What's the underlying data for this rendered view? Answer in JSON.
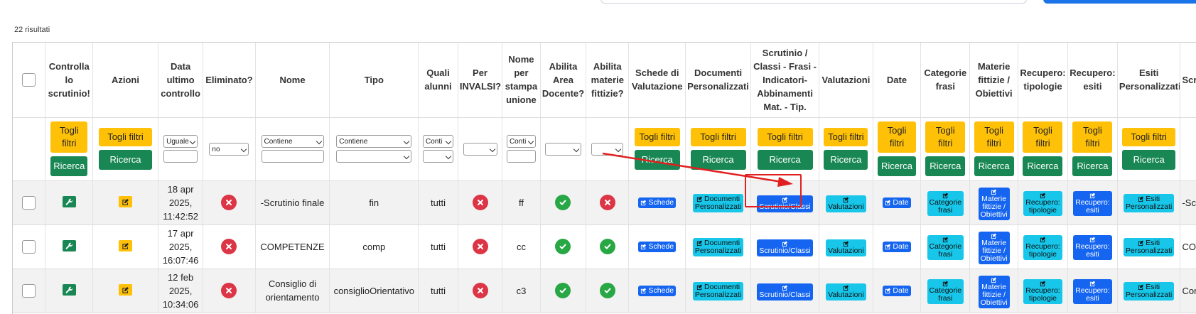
{
  "results_count": "22 risultati",
  "headers": [
    "",
    "Controlla lo scrutinio!",
    "Azioni",
    "Data ultimo controllo",
    "Eliminato?",
    "Nome",
    "Tipo",
    "Quali alunni",
    "Per INVALSI?",
    "Nome per stampa unione",
    "Abilita Area Docente?",
    "Abilita materie fittizie?",
    "Schede di Valutazione",
    "Documenti Personalizzati",
    "Scrutinio / Classi - Frasi - Indicatori- Abbinamenti Mat. - Tip.",
    "Valutazioni",
    "Date",
    "Categorie frasi",
    "Materie fittizie / Obiettivi",
    "Recupero: tipologie",
    "Recupero: esiti",
    "Esiti Personalizzati",
    "Scr"
  ],
  "filters": {
    "togli_filtri": "Togli filtri",
    "ricerca": "Ricerca",
    "data_op": "Uguale",
    "eliminato": "no",
    "nome_op": "Contiene",
    "tipo_op": "Contiene",
    "alunni_op": "Conti",
    "stampa_op": "Conti"
  },
  "buttons": {
    "schede": "Schede",
    "documenti_l1": "Documenti",
    "documenti_l2": "Personalizzati",
    "scrutinio_classi": "Scrutinio/Classi",
    "valutazioni": "Valutazioni",
    "date": "Date",
    "categorie_l1": "Categorie",
    "categorie_l2": "frasi",
    "materie_l1": "Materie",
    "materie_l2": "fittizie /",
    "materie_l3": "Obiettivi",
    "rec_tip_l1": "Recupero:",
    "rec_tip_l2": "tipologie",
    "rec_esiti_l1": "Recupero:",
    "rec_esiti_l2": "esiti",
    "esiti_l1": "Esiti",
    "esiti_l2": "Personalizzati"
  },
  "rows": [
    {
      "data_l1": "18 apr",
      "data_l2": "2025,",
      "data_l3": "11:42:52",
      "eliminato": "no",
      "nome_l1": "-Scrutinio finale",
      "nome_l2": "",
      "tipo": "fin",
      "alunni": "tutti",
      "invalsi": "no",
      "stampa": "ff",
      "area_docente": "yes",
      "materie_fittizie": "no",
      "last": "-Scruti"
    },
    {
      "data_l1": "17 apr",
      "data_l2": "2025,",
      "data_l3": "16:07:46",
      "eliminato": "no",
      "nome_l1": "COMPETENZE",
      "nome_l2": "",
      "tipo": "comp",
      "alunni": "tutti",
      "invalsi": "no",
      "stampa": "cc",
      "area_docente": "yes",
      "materie_fittizie": "yes",
      "last": "COMP"
    },
    {
      "data_l1": "12 feb",
      "data_l2": "2025,",
      "data_l3": "10:34:06",
      "eliminato": "no",
      "nome_l1": "Consiglio di",
      "nome_l2": "orientamento",
      "tipo": "consiglioOrientativo",
      "alunni": "tutti",
      "invalsi": "no",
      "stampa": "c3",
      "area_docente": "yes",
      "materie_fittizie": "yes",
      "last": "Cons orien"
    }
  ],
  "colors": {
    "yellow": "#ffc107",
    "green": "#198754",
    "cyan": "#17c6e9",
    "blue": "#1565f0",
    "red": "#dc3545",
    "ok": "#28a745",
    "annotation": "#e02020"
  }
}
